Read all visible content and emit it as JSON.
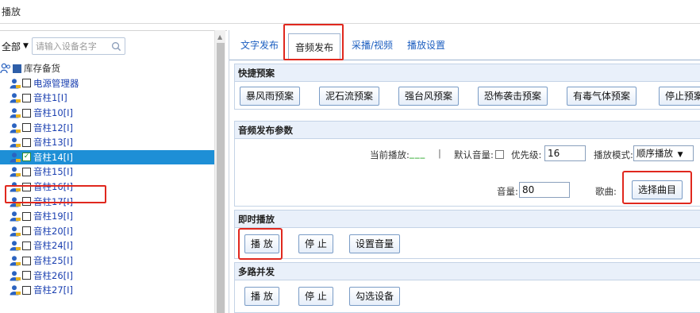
{
  "window": {
    "title": "播放"
  },
  "left": {
    "filter": {
      "scope": "全部",
      "search_placeholder": "请输入设备名字"
    },
    "tree": {
      "root": "库存备货",
      "items": [
        {
          "label": "电源管理器",
          "checked": false
        },
        {
          "label": "音柱1[I]",
          "checked": false
        },
        {
          "label": "音柱10[I]",
          "checked": false
        },
        {
          "label": "音柱12[I]",
          "checked": false
        },
        {
          "label": "音柱13[I]",
          "checked": false
        },
        {
          "label": "音柱14[I]",
          "checked": true,
          "selected": true
        },
        {
          "label": "音柱15[I]",
          "checked": false
        },
        {
          "label": "音柱16[I]",
          "checked": false
        },
        {
          "label": "音柱17[I]",
          "checked": false
        },
        {
          "label": "音柱19[I]",
          "checked": false
        },
        {
          "label": "音柱20[I]",
          "checked": false
        },
        {
          "label": "音柱24[I]",
          "checked": false
        },
        {
          "label": "音柱25[I]",
          "checked": false
        },
        {
          "label": "音柱26[I]",
          "checked": false
        },
        {
          "label": "音柱27[I]",
          "checked": false
        }
      ]
    }
  },
  "tabs": [
    {
      "label": "文字发布"
    },
    {
      "label": "音频发布",
      "active": true
    },
    {
      "label": "采播/视频"
    },
    {
      "label": "播放设置"
    }
  ],
  "quick_plan": {
    "title": "快捷预案",
    "buttons": [
      "暴风雨预案",
      "泥石流预案",
      "强台风预案",
      "恐怖袭击预案",
      "有毒气体预案",
      "停止预案"
    ]
  },
  "params": {
    "title": "音频发布参数",
    "current_play_label": "当前播放:",
    "current_play_value": "___",
    "separator": "|",
    "default_volume_label": "默认音量:",
    "priority_label": "优先级:",
    "priority_value": "16",
    "mode_label": "播放模式:",
    "mode_value": "顺序播放",
    "volume_label": "音量:",
    "volume_value": "80",
    "song_label": "歌曲:",
    "choose_song": "选择曲目"
  },
  "instant": {
    "title": "即时播放",
    "play": "播 放",
    "stop": "停 止",
    "set_volume": "设置音量"
  },
  "multi": {
    "title": "多路并发",
    "play": "播 放",
    "stop": "停 止",
    "select_devices": "勾选设备"
  },
  "colors": {
    "selection": "#1e8fd6",
    "highlight": "#e0281e",
    "link": "#1d5fc0",
    "section_header": "#e9f0fa"
  }
}
